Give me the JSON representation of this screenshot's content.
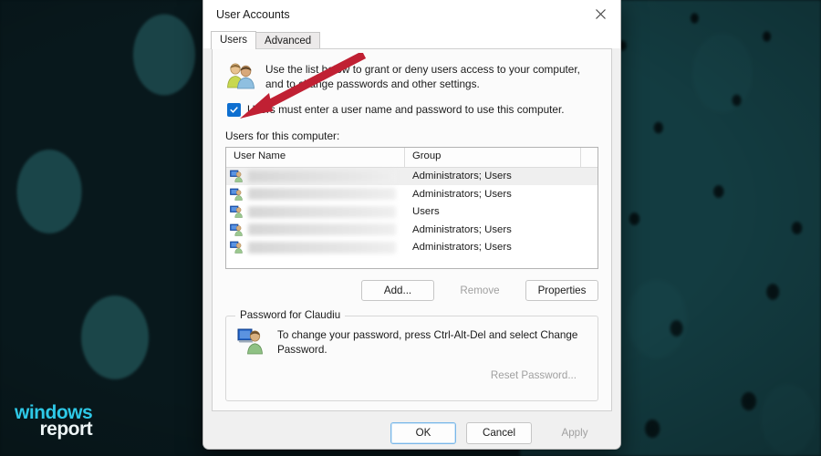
{
  "window": {
    "title": "User Accounts",
    "close_icon": "close-icon"
  },
  "tabs": [
    {
      "label": "Users",
      "selected": true
    },
    {
      "label": "Advanced",
      "selected": false
    }
  ],
  "intro": {
    "icon": "two-users-icon",
    "line1": "Use the list below to grant or deny users access to your computer,",
    "line2": "and to change passwords and other settings."
  },
  "checkbox": {
    "label": "Users must enter a user name and password to use this computer.",
    "checked": true,
    "accent_color": "#0e6fd0"
  },
  "users_list": {
    "label": "Users for this computer:",
    "columns": [
      "User Name",
      "Group",
      ""
    ],
    "rows": [
      {
        "user_name": "",
        "redacted": true,
        "group": "Administrators; Users",
        "selected": true
      },
      {
        "user_name": "",
        "redacted": true,
        "group": "Administrators; Users",
        "selected": false
      },
      {
        "user_name": "",
        "redacted": true,
        "group": "Users",
        "selected": false
      },
      {
        "user_name": "",
        "redacted": true,
        "group": "Administrators; Users",
        "selected": false
      },
      {
        "user_name": "",
        "redacted": true,
        "group": "Administrators; Users",
        "selected": false
      }
    ]
  },
  "list_buttons": {
    "add": "Add...",
    "remove": "Remove",
    "properties": "Properties"
  },
  "password_group": {
    "legend": "Password for Claudiu",
    "icon": "user-monitor-icon",
    "text": "To change your password, press Ctrl-Alt-Del and select Change Password.",
    "reset_button": "Reset Password..."
  },
  "footer": {
    "ok": "OK",
    "cancel": "Cancel",
    "apply": "Apply"
  },
  "annotation": {
    "type": "red-arrow",
    "color": "#c02033",
    "points_to": "checkbox"
  },
  "watermark": {
    "line1": "windows",
    "line2": "report",
    "color1": "#2ec8e6",
    "color2": "#eef6f7"
  }
}
